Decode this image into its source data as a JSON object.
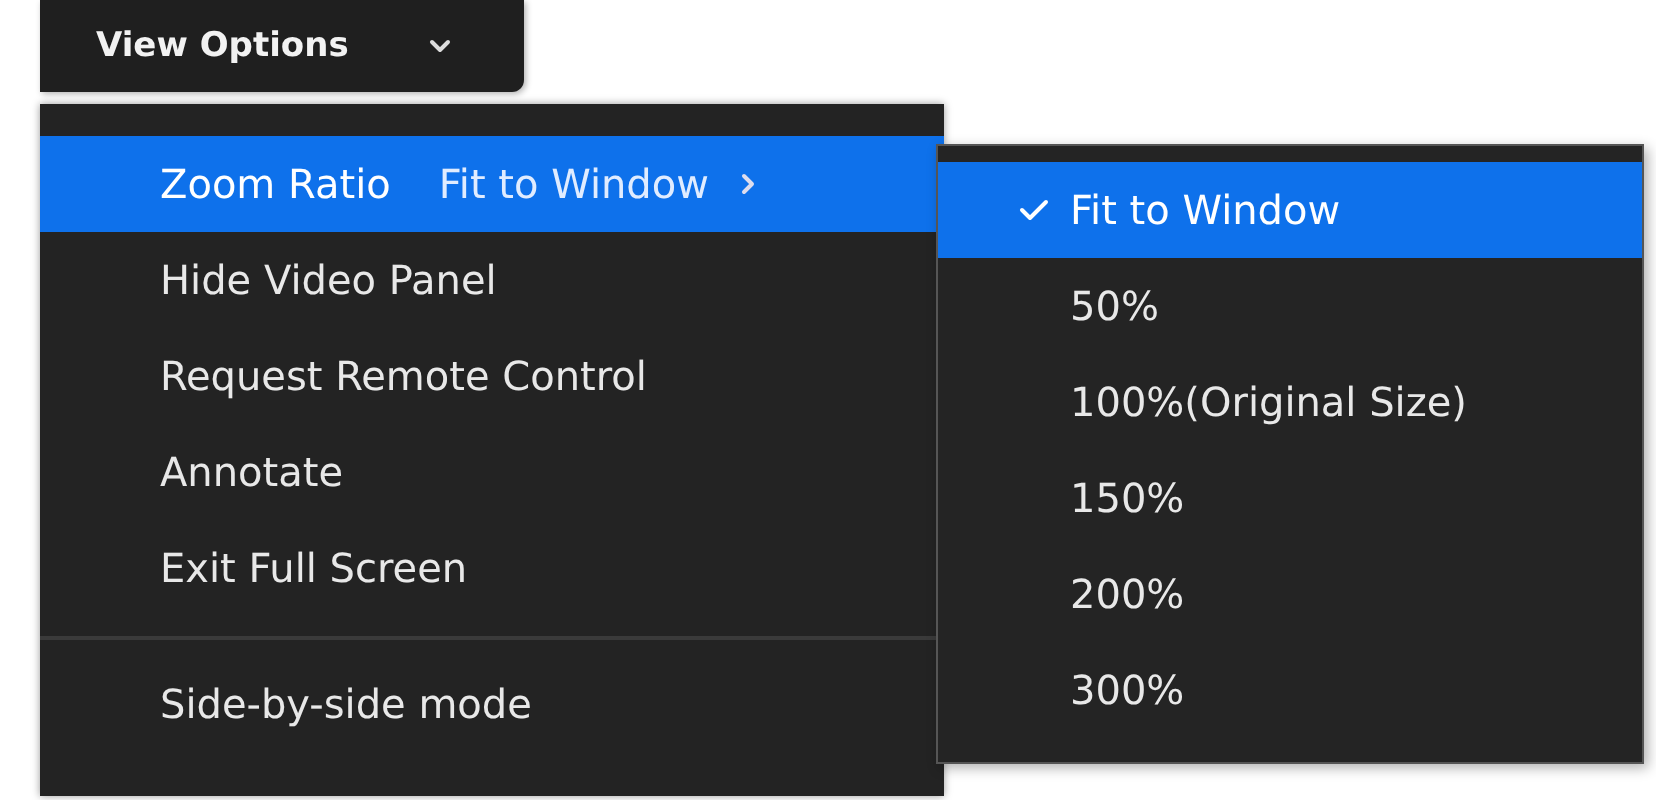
{
  "button": {
    "label": "View Options"
  },
  "menu": {
    "sections": [
      {
        "items": [
          {
            "label": "Zoom Ratio",
            "value": "Fit to Window",
            "has_submenu": true,
            "selected": true
          },
          {
            "label": "Hide Video Panel",
            "has_submenu": false,
            "selected": false
          },
          {
            "label": "Request Remote Control",
            "has_submenu": false,
            "selected": false
          },
          {
            "label": "Annotate",
            "has_submenu": false,
            "selected": false
          },
          {
            "label": "Exit Full Screen",
            "has_submenu": false,
            "selected": false
          }
        ]
      },
      {
        "items": [
          {
            "label": "Side-by-side mode",
            "has_submenu": false,
            "selected": false
          }
        ]
      }
    ]
  },
  "submenu": {
    "items": [
      {
        "label": "Fit to Window",
        "checked": true,
        "selected": true
      },
      {
        "label": "50%",
        "checked": false,
        "selected": false
      },
      {
        "label": "100%(Original Size)",
        "checked": false,
        "selected": false
      },
      {
        "label": "150%",
        "checked": false,
        "selected": false
      },
      {
        "label": "200%",
        "checked": false,
        "selected": false
      },
      {
        "label": "300%",
        "checked": false,
        "selected": false
      }
    ]
  }
}
